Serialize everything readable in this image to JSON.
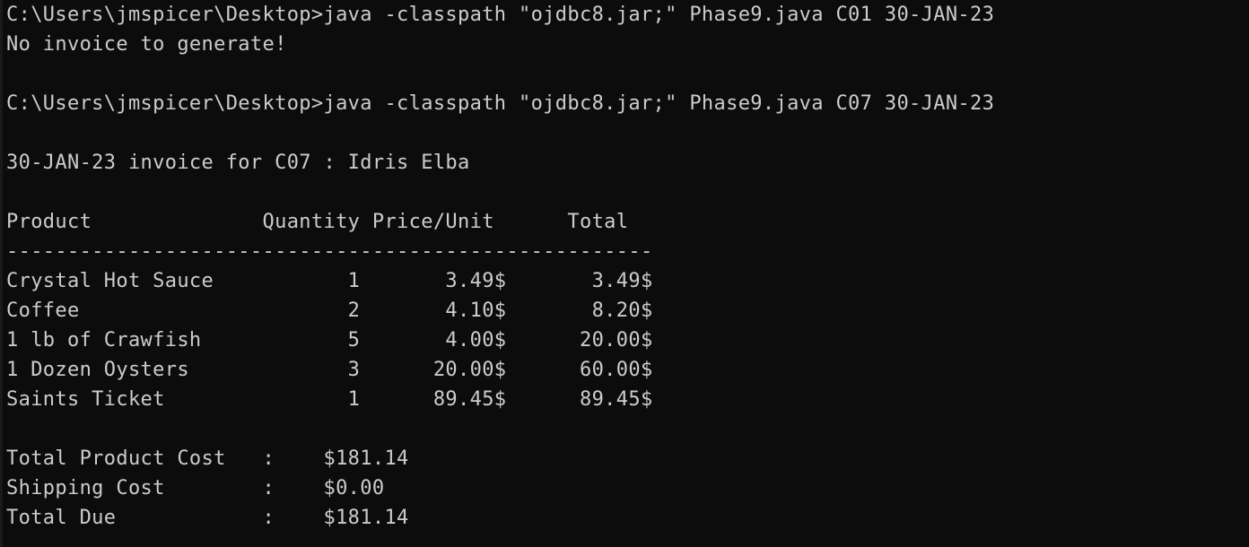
{
  "terminal": {
    "lines": [
      "C:\\Users\\jmspicer\\Desktop>java -classpath \"ojdbc8.jar;\" Phase9.java C01 30-JAN-23",
      "No invoice to generate!",
      "",
      "C:\\Users\\jmspicer\\Desktop>java -classpath \"ojdbc8.jar;\" Phase9.java C07 30-JAN-23",
      "",
      "30-JAN-23 invoice for C07 : Idris Elba",
      "",
      "Product              Quantity Price/Unit      Total",
      "-----------------------------------------------------",
      "Crystal Hot Sauce           1       3.49$       3.49$",
      "Coffee                      2       4.10$       8.20$",
      "1 lb of Crawfish            5       4.00$      20.00$",
      "1 Dozen Oysters             3      20.00$      60.00$",
      "Saints Ticket               1      89.45$      89.45$",
      "",
      "Total Product Cost   :    $181.14",
      "Shipping Cost        :    $0.00",
      "Total Due            :    $181.14"
    ]
  }
}
